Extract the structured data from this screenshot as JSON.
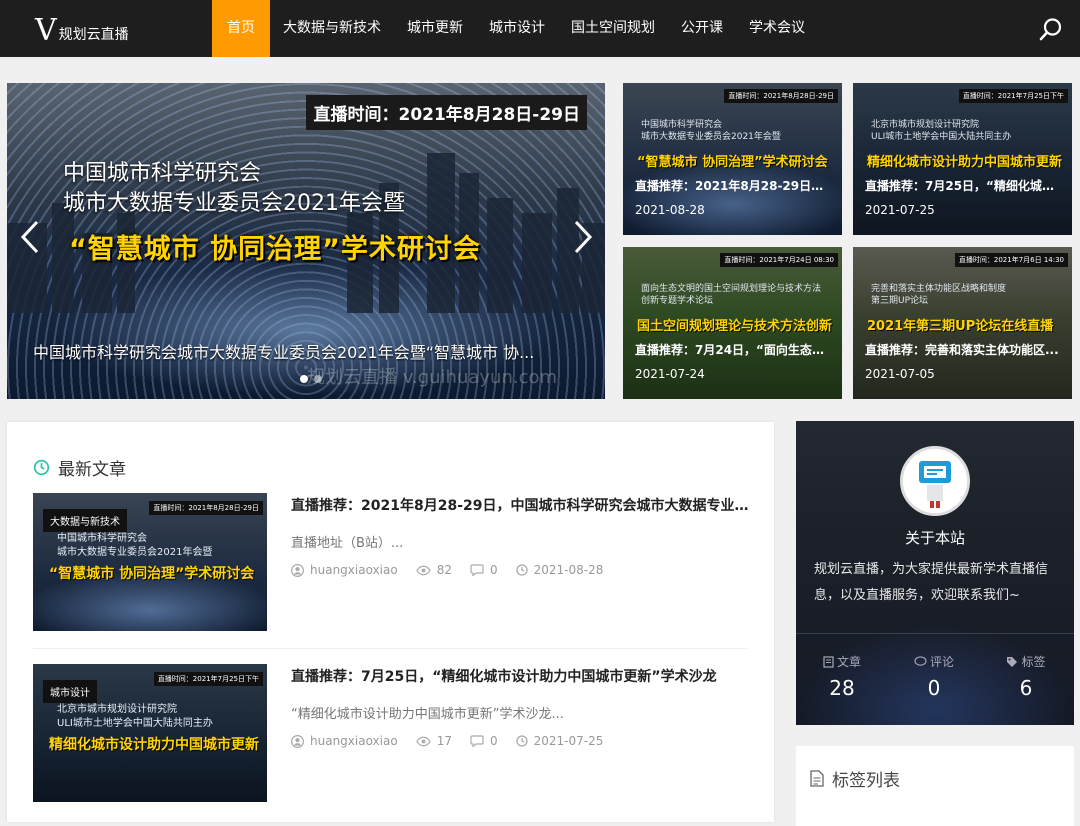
{
  "header": {
    "logo_letter": "V",
    "logo_text": "规划云直播",
    "nav": [
      {
        "label": "首页",
        "active": true
      },
      {
        "label": "大数据与新技术"
      },
      {
        "label": "城市更新"
      },
      {
        "label": "城市设计"
      },
      {
        "label": "国土空间规划"
      },
      {
        "label": "公开课"
      },
      {
        "label": "学术会议"
      }
    ],
    "search_icon": "search-icon"
  },
  "slider": {
    "live_time": "直播时间：2021年8月28日-29日",
    "line1": "中国城市科学研究会",
    "line2": "城市大数据专业委员会2021年会暨",
    "headline": "“智慧城市 协同治理”学术研讨会",
    "caption": "中国城市科学研究会城市大数据专业委员会2021年会暨“智慧城市 协...",
    "watermark": "规划云直播 v.guihuayun.com",
    "dots": 2,
    "active_dot": 0
  },
  "featured": [
    {
      "tag": "直播时间：2021年8月28日-29日",
      "sub1": "中国城市科学研究会",
      "sub2": "城市大数据专业委员会2021年会暨",
      "big": "“智慧城市 协同治理”学术研讨会",
      "title": "直播推荐：2021年8月28-29日，...",
      "date": "2021-08-28"
    },
    {
      "tag": "直播时间：2021年7月25日下午",
      "sub1": "北京市城市规划设计研究院",
      "sub2": "ULI城市土地学会中国大陆共同主办",
      "big": "精细化城市设计助力中国城市更新",
      "title": "直播推荐：7月25日，“精细化城市...",
      "date": "2021-07-25"
    },
    {
      "tag": "直播时间：2021年7月24日 08:30",
      "sub1": "面向生态文明的国土空间规划理论与技术方法",
      "sub2": "创新专题学术论坛",
      "big": "国土空间规划理论与技术方法创新",
      "title": "直播推荐：7月24日，“面向生态文...",
      "date": "2021-07-24"
    },
    {
      "tag": "直播时间：2021年7月6日 14:30",
      "sub1": "完善和落实主体功能区战略和制度",
      "sub2": "第三期UP论坛",
      "big": "2021年第三期UP论坛在线直播",
      "title": "直播推荐：完善和落实主体功能区...",
      "date": "2021-07-05"
    }
  ],
  "latest": {
    "heading": "最新文章",
    "articles": [
      {
        "category": "大数据与新技术",
        "img_tag": "直播时间：2021年8月28日-29日",
        "img_line1": "中国城市科学研究会",
        "img_line2": "城市大数据专业委员会2021年会暨",
        "img_big": "“智慧城市 协同治理”学术研讨会",
        "title": "直播推荐：2021年8月28-29日，中国城市科学研究会城市大数据专业委...",
        "excerpt": "直播地址（B站）...",
        "author": "huangxiaoxiao",
        "views": "82",
        "comments": "0",
        "date": "2021-08-28"
      },
      {
        "category": "城市设计",
        "img_tag": "直播时间：2021年7月25日下午",
        "img_line1": "北京市城市规划设计研究院",
        "img_line2": "ULI城市土地学会中国大陆共同主办",
        "img_big": "精细化城市设计助力中国城市更新",
        "title": "直播推荐：7月25日，“精细化城市设计助力中国城市更新”学术沙龙",
        "excerpt": "“精细化城市设计助力中国城市更新”学术沙龙...",
        "author": "huangxiaoxiao",
        "views": "17",
        "comments": "0",
        "date": "2021-07-25"
      }
    ]
  },
  "about": {
    "title": "关于本站",
    "description": "规划云直播，为大家提供最新学术直播信息，以及直播服务，欢迎联系我们~",
    "stats": [
      {
        "label": "文章",
        "value": "28"
      },
      {
        "label": "评论",
        "value": "0"
      },
      {
        "label": "标签",
        "value": "6"
      }
    ]
  },
  "tags": {
    "heading": "标签列表"
  }
}
